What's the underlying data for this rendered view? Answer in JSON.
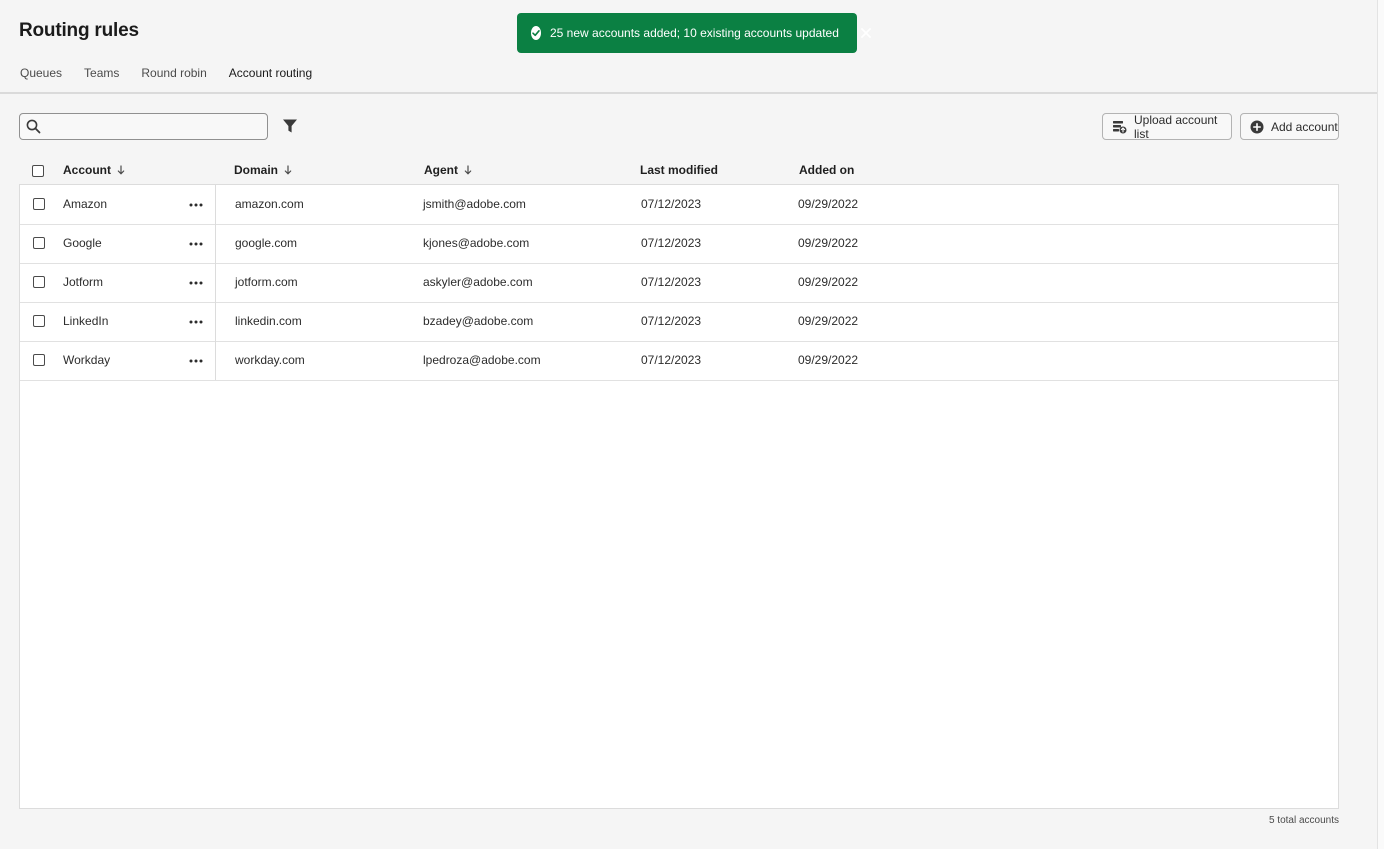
{
  "page": {
    "title": "Routing rules"
  },
  "tabs": [
    {
      "label": "Queues",
      "active": false
    },
    {
      "label": "Teams",
      "active": false
    },
    {
      "label": "Round robin",
      "active": false
    },
    {
      "label": "Account routing",
      "active": true
    }
  ],
  "toast": {
    "message": "25 new accounts added; 10 existing accounts updated",
    "color": "#0b8043"
  },
  "search": {
    "value": "",
    "placeholder": ""
  },
  "buttons": {
    "upload_label": "Upload account list",
    "add_label": "Add account"
  },
  "table": {
    "columns": {
      "account": "Account",
      "domain": "Domain",
      "agent": "Agent",
      "last_modified": "Last modified",
      "added_on": "Added on"
    },
    "rows": [
      {
        "account": "Amazon",
        "domain": "amazon.com",
        "agent": "jsmith@adobe.com",
        "last_modified": "07/12/2023",
        "added_on": "09/29/2022"
      },
      {
        "account": "Google",
        "domain": "google.com",
        "agent": "kjones@adobe.com",
        "last_modified": "07/12/2023",
        "added_on": "09/29/2022"
      },
      {
        "account": "Jotform",
        "domain": "jotform.com",
        "agent": "askyler@adobe.com",
        "last_modified": "07/12/2023",
        "added_on": "09/29/2022"
      },
      {
        "account": "LinkedIn",
        "domain": "linkedin.com",
        "agent": "bzadey@adobe.com",
        "last_modified": "07/12/2023",
        "added_on": "09/29/2022"
      },
      {
        "account": "Workday",
        "domain": "workday.com",
        "agent": "lpedroza@adobe.com",
        "last_modified": "07/12/2023",
        "added_on": "09/29/2022"
      }
    ]
  },
  "footer": {
    "total": "5 total accounts"
  },
  "icons": {
    "success": "check-circle-icon",
    "close": "close-icon",
    "search": "search-icon",
    "filter": "filter-icon",
    "upload": "upload-list-icon",
    "add": "add-circle-icon",
    "sort": "sort-down-arrow-icon",
    "more": "more-actions-icon"
  }
}
